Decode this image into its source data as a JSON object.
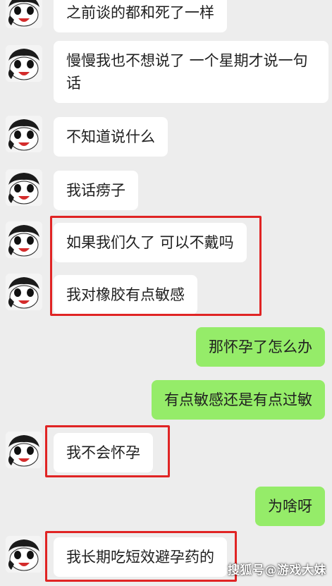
{
  "messages": [
    {
      "sender": "contact",
      "text": "之前谈的都和死了一样"
    },
    {
      "sender": "contact",
      "text": "慢慢我也不想说了 一个星期才说一句话"
    },
    {
      "sender": "contact",
      "text": "不知道说什么"
    },
    {
      "sender": "contact",
      "text": "我话痨子"
    },
    {
      "sender": "contact",
      "text": "如果我们久了 可以不戴吗"
    },
    {
      "sender": "contact",
      "text": "我对橡胶有点敏感"
    },
    {
      "sender": "me",
      "text": "那怀孕了怎么办"
    },
    {
      "sender": "me",
      "text": "有点敏感还是有点过敏"
    },
    {
      "sender": "contact",
      "text": "我不会怀孕"
    },
    {
      "sender": "me",
      "text": "为啥呀"
    },
    {
      "sender": "contact",
      "text": "我长期吃短效避孕药的"
    }
  ],
  "colors": {
    "background": "#ededed",
    "incoming_bubble": "#ffffff",
    "outgoing_bubble": "#95ec69",
    "highlight_box": "#e02424"
  },
  "watermark": "搜狐号@游戏大妹"
}
